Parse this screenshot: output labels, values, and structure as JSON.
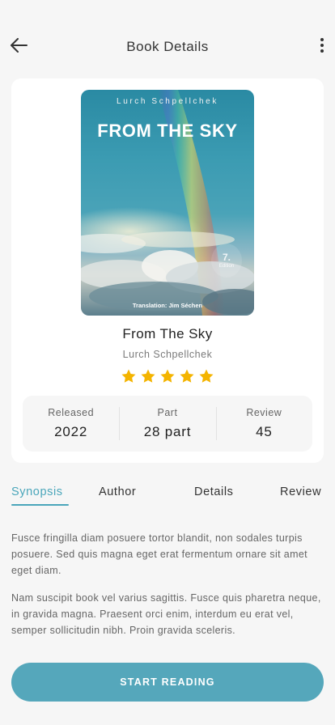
{
  "header": {
    "title": "Book Details",
    "back_icon": "arrow-left-icon",
    "more_icon": "more-vertical-icon"
  },
  "book": {
    "cover": {
      "author": "Lurch Schpellchek",
      "title": "FROM THE SKY",
      "edition_number": "7.",
      "edition_label": "Edition",
      "translation": "Translation: Jim Séchen"
    },
    "title": "From The Sky",
    "author": "Lurch Schpellchek",
    "rating": 5,
    "rating_max": 5
  },
  "stats": [
    {
      "label": "Released",
      "value": "2022"
    },
    {
      "label": "Part",
      "value": "28 part"
    },
    {
      "label": "Review",
      "value": "45"
    }
  ],
  "tabs": [
    {
      "label": "Synopsis",
      "active": true
    },
    {
      "label": "Author",
      "active": false
    },
    {
      "label": "Details",
      "active": false
    },
    {
      "label": "Review",
      "active": false
    }
  ],
  "synopsis": {
    "paragraphs": [
      "Fusce fringilla diam posuere tortor blandit, non sodales turpis posuere. Sed quis magna eget erat fermentum ornare sit amet eget diam.",
      "Nam suscipit book vel varius sagittis. Fusce quis pharetra neque, in gravida magna. Praesent orci enim, interdum eu erat vel, semper sollicitudin nibh. Proin gravida sceleris."
    ]
  },
  "cta": {
    "label": "START READING"
  },
  "colors": {
    "accent": "#4aa6ba",
    "button": "#55a7bb",
    "star": "#f4b400",
    "background": "#f6f6f6"
  }
}
